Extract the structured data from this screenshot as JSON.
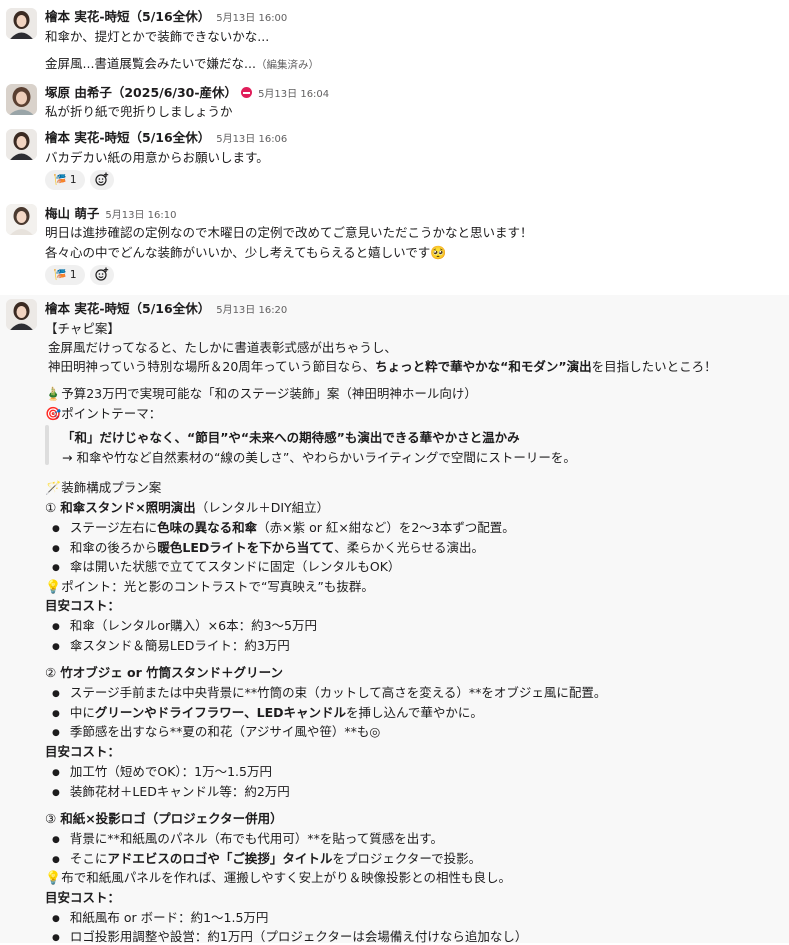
{
  "messages": [
    {
      "author": "檜本 実花-時短（5/16全休）",
      "time": "5月13日 16:00",
      "lines": [
        "和傘か、提灯とかで装飾できないかな...",
        "金屏風...書道展覧会みたいで嫌だな..."
      ],
      "edited": "（編集済み）"
    },
    {
      "author": "塚原 由希子（2025/6/30-産休）",
      "time": "5月13日 16:04",
      "status_icon": "no-entry-icon",
      "lines": [
        "私が折り紙で兜折りしましょうか"
      ]
    },
    {
      "author": "檜本 実花-時短（5/16全休）",
      "time": "5月13日 16:06",
      "lines": [
        "バカデカい紙の用意からお願いします。"
      ],
      "reaction": {
        "emoji": "🎏",
        "count": "1"
      }
    },
    {
      "author": "梅山 萌子",
      "time": "5月13日 16:10",
      "lines": [
        "明日は進捗確認の定例なので木曜日の定例で改めてご意見いただこうかなと思います！",
        "各々心の中でどんな装飾がいいか、少し考えてもらえると嬉しいです"
      ],
      "line_emoji": "🥺",
      "reaction": {
        "emoji": "🎏",
        "count": "1"
      }
    },
    {
      "author": "檜本 実花-時短（5/16全休）",
      "time": "5月13日 16:20",
      "proposal": {
        "header": "【チャピ案】",
        "intro1": "金屏風だけってなると、たしかに書道表彰式感が出ちゃうし、",
        "intro2_a": "神田明神っていう特別な場所＆20周年っていう節目なら、",
        "intro2_b": "ちょっと粋で華やかな“和モダン”演出",
        "intro2_c": "を目指したいところ！",
        "budget_emoji": "🎍",
        "budget": "予算23万円で実現可能な「和のステージ装飾」案（神田明神ホール向け）",
        "theme_emoji": "🎯",
        "theme": "ポイントテーマ：",
        "quote1": "「和」だけじゃなく、“節目”や“未来への期待感”も演出できる華やかさと温かみ",
        "quote2": "→ 和傘や竹など自然素材の“線の美しさ”、やわらかいライティングで空間にストーリーを。",
        "plan_emoji": "🪄",
        "plan_title": "装飾構成プラン案",
        "s1_num": "①",
        "s1_title": "和傘スタンド×照明演出",
        "s1_note": "（レンタル＋DIY組立）",
        "s1_b1_a": "ステージ左右に",
        "s1_b1_b": "色味の異なる和傘",
        "s1_b1_c": "（赤×紫 or 紅×紺など）を2〜3本ずつ配置。",
        "s1_b2_a": "和傘の後ろから",
        "s1_b2_b": "暖色LEDライトを下から当てて",
        "s1_b2_c": "、柔らかく光らせる演出。",
        "s1_b3": "傘は開いた状態で立ててスタンドに固定（レンタルもOK）",
        "tip_emoji": "💡",
        "s1_tip": "ポイント：光と影のコントラストで“写真映え”も抜群。",
        "cost_label": "目安コスト：",
        "s1_c1": "和傘（レンタルor購入）×6本：約3〜5万円",
        "s1_c2": "傘スタンド＆簡易LEDライト：約3万円",
        "s2_num": "②",
        "s2_title": "竹オブジェ or 竹筒スタンド＋グリーン",
        "s2_b1": "ステージ手前または中央背景に**竹筒の束（カットして高さを変える）**をオブジェ風に配置。",
        "s2_b2_a": "中に",
        "s2_b2_b": "グリーンやドライフラワー、LEDキャンドル",
        "s2_b2_c": "を挿し込んで華やかに。",
        "s2_b3": "季節感を出すなら**夏の和花（アジサイ風や笹）**も◎",
        "s2_c1": "加工竹（短めでOK）：1万〜1.5万円",
        "s2_c2": "装飾花材＋LEDキャンドル等：約2万円",
        "s3_num": "③",
        "s3_title": "和紙×投影ロゴ（プロジェクター併用）",
        "s3_b1": "背景に**和紙風のパネル（布でも代用可）**を貼って質感を出す。",
        "s3_b2_a": "そこに",
        "s3_b2_b": "アドエビスのロゴや「ご挨拶」タイトル",
        "s3_b2_c": "をプロジェクターで投影。",
        "s3_tip": "布で和紙風パネルを作れば、運搬しやすく安上がり＆映像投影との相性も良し。",
        "s3_c1": "和紙風布 or ボード：約1〜1.5万円",
        "s3_c2": "ロゴ投影用調整や設営：約1万円（プロジェクターは会場備え付けなら追加なし）"
      }
    }
  ]
}
